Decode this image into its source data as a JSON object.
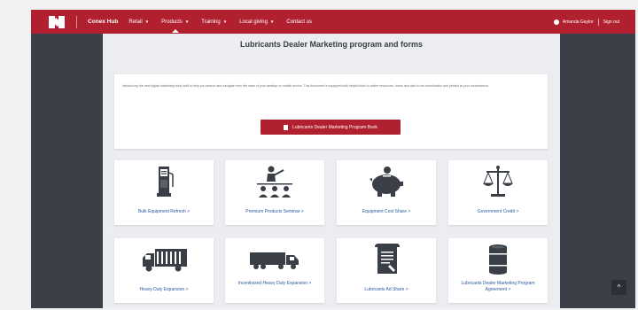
{
  "navbar": {
    "brand": "Conex Hub",
    "items": [
      {
        "label": "Retail",
        "caret": "▼"
      },
      {
        "label": "Products",
        "caret": "▼"
      },
      {
        "label": "Training",
        "caret": "▼"
      },
      {
        "label": "Local giving",
        "caret": "▼"
      },
      {
        "label": "Contact us",
        "caret": ""
      }
    ],
    "user_name": "Amanda Gaylor",
    "sign_out": "Sign out"
  },
  "page": {
    "title": "Lubricants Dealer Marketing program and forms",
    "intro": "Introducing the new digital marketing book built to help you search and navigate from the ease of your desktop or mobile device. This document is equipped with helpful links to online resources, forms and also to be downloaded and printed at your convenience.",
    "button_label": "Lubricants Dealer Marketing Program Book"
  },
  "cards": [
    {
      "label": "Bulk Equipment Refresh >",
      "icon": "fuel-pump-icon"
    },
    {
      "label": "Premium Products Seminar >",
      "icon": "seminar-presenter-icon"
    },
    {
      "label": "Equipment Cost Share >",
      "icon": "piggy-bank-icon"
    },
    {
      "label": "Government Credit >",
      "icon": "scales-icon"
    },
    {
      "label": "Heavy Duty Expansion >",
      "icon": "box-truck-icon"
    },
    {
      "label": "Incentivized Heavy Duty Expansion >",
      "icon": "semi-truck-icon"
    },
    {
      "label": "Lubricants Ad Share >",
      "icon": "document-pen-icon"
    },
    {
      "label": "Lubricants Dealer Marketing Program Agreement >",
      "icon": "oil-drum-icon"
    }
  ],
  "colors": {
    "brand_red": "#b1202f",
    "frame": "#3b4048",
    "content_bg": "#ebedf0",
    "link": "#2a5a9e"
  }
}
